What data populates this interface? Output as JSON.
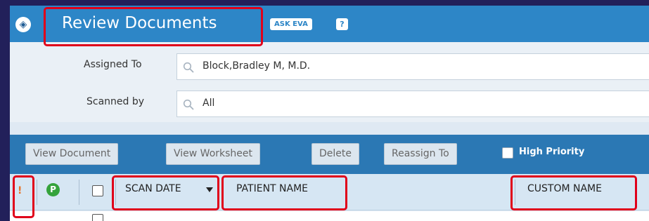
{
  "header": {
    "title": "Review Documents",
    "ask_eva": "ASK EVA",
    "help": "?",
    "app_icon": "document-stack-icon"
  },
  "filters": {
    "assigned_to": {
      "label": "Assigned To",
      "value": "Block,Bradley M, M.D."
    },
    "scanned_by": {
      "label": "Scanned by",
      "value": "All"
    }
  },
  "toolbar": {
    "view_document": "View Document",
    "view_worksheet": "View Worksheet",
    "delete": "Delete",
    "reassign_to": "Reassign To",
    "high_priority": "High Priority",
    "high_priority_checked": false
  },
  "grid": {
    "priority_symbol": "!",
    "p_symbol": "P",
    "columns": {
      "scan_date": "SCAN DATE",
      "patient_name": "PATIENT NAME",
      "custom_name": "CUSTOM NAME"
    },
    "sort": {
      "column": "SCAN DATE",
      "direction": "descending"
    }
  },
  "colors": {
    "title_bar": "#2d86c7",
    "toolbar": "#2b78b4",
    "highlight": "#e0001a",
    "priority_orange": "#e8742a",
    "p_green": "#35a33c"
  }
}
